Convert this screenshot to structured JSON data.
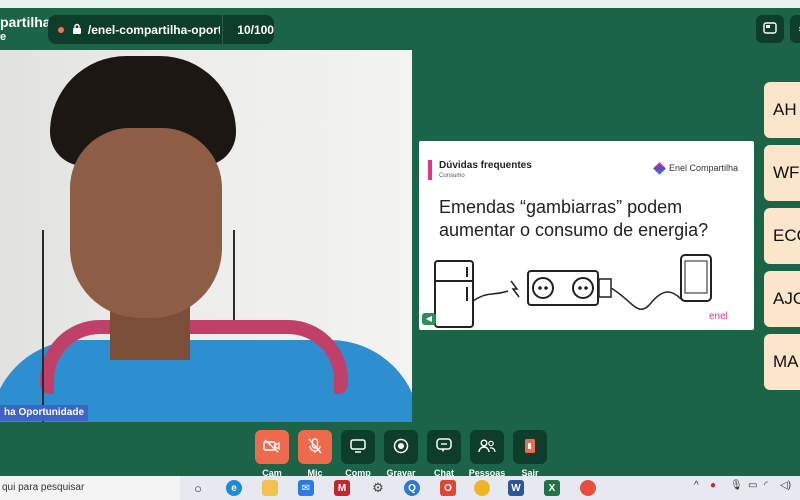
{
  "header": {
    "room_title": "partilha",
    "room_subtitle": "e",
    "url": "/enel-compartilha-oport...",
    "participants_count": "10/100"
  },
  "video": {
    "participant_name": "ha Oportunidade"
  },
  "slide": {
    "title": "Dúvidas frequentes",
    "subtitle": "Consumo",
    "brand": "Enel Compartilha",
    "question": "Emendas “gambiarras” podem aumentar o consumo de energia?",
    "logo_text": "enel"
  },
  "side_buttons": [
    "AH",
    "WF",
    "ECO",
    "AJO",
    "MA"
  ],
  "controls": [
    {
      "label": "Cam",
      "icon": "camera-off-icon",
      "style": "red"
    },
    {
      "label": "Mic",
      "icon": "mic-off-icon",
      "style": "red"
    },
    {
      "label": "Comp",
      "icon": "screen-share-icon",
      "style": "dark"
    },
    {
      "label": "Gravar",
      "icon": "record-icon",
      "style": "dark"
    },
    {
      "label": "Chat",
      "icon": "chat-icon",
      "style": "dark"
    },
    {
      "label": "Pessoas",
      "icon": "people-icon",
      "style": "dark"
    },
    {
      "label": "Sair",
      "icon": "exit-icon",
      "style": "dark"
    }
  ],
  "taskbar": {
    "search_placeholder": "qui para pesquisar"
  },
  "colors": {
    "background": "#1b6447",
    "control_dark": "#0f3d2b",
    "control_red": "#ef6a4c",
    "accent_pink": "#e0348d",
    "name_chip": "#3e63c6",
    "side_button": "#fbe6cc"
  }
}
